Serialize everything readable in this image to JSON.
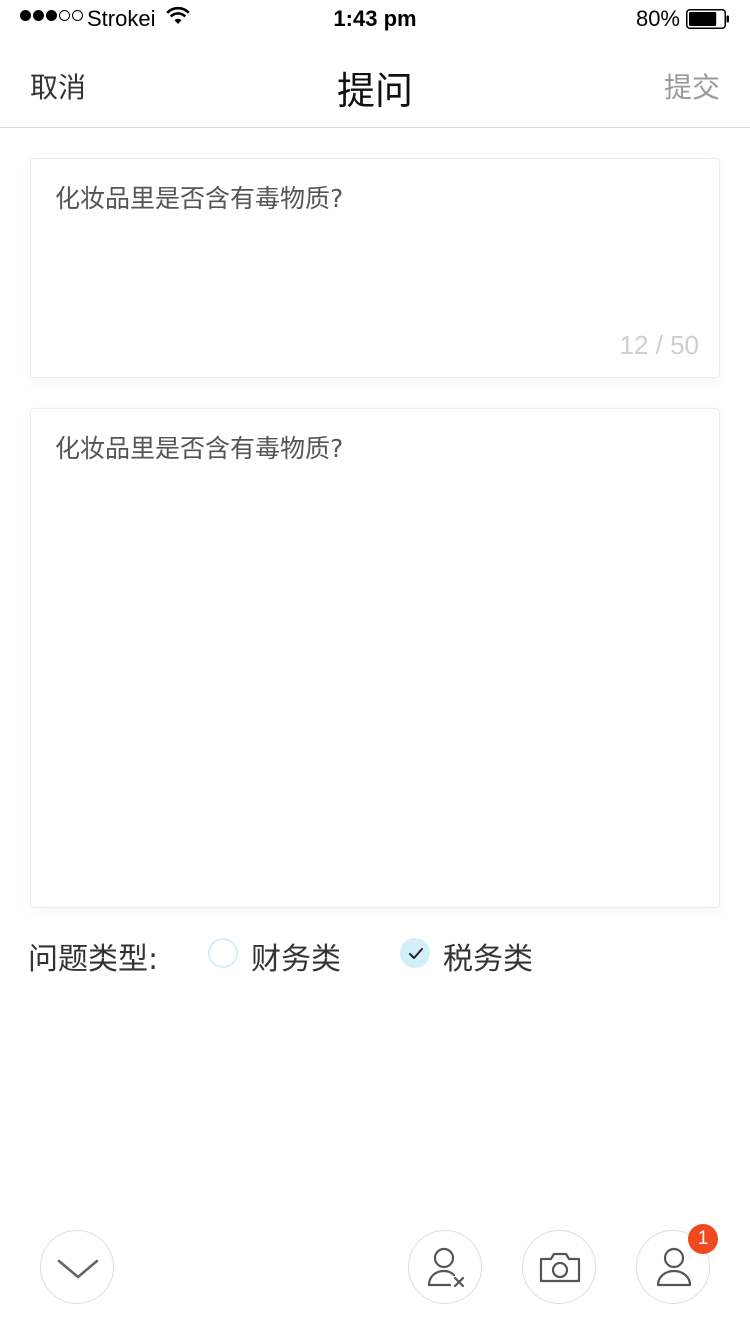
{
  "status_bar": {
    "carrier": "Strokei",
    "signal_bars_filled": 3,
    "signal_bars_total": 5,
    "time": "1:43 pm",
    "battery_percent": "80%",
    "battery_level": 0.8
  },
  "nav": {
    "cancel_label": "取消",
    "title": "提问",
    "submit_label": "提交"
  },
  "question_title": {
    "value": "化妆品里是否含有毒物质?",
    "counter": "12 / 50"
  },
  "question_body": {
    "value": "化妆品里是否含有毒物质?"
  },
  "question_type": {
    "label": "问题类型:",
    "options": [
      {
        "label": "财务类",
        "selected": false
      },
      {
        "label": "税务类",
        "selected": true
      }
    ]
  },
  "toolbar": {
    "icons": [
      "chevron-down-icon",
      "remove-user-icon",
      "camera-icon",
      "user-icon"
    ],
    "badge_count": "1"
  },
  "colors": {
    "accent_light_blue": "#d2eff9",
    "badge_red": "#ef4a1f",
    "divider": "#d9d9d9",
    "muted_text": "#999999"
  }
}
